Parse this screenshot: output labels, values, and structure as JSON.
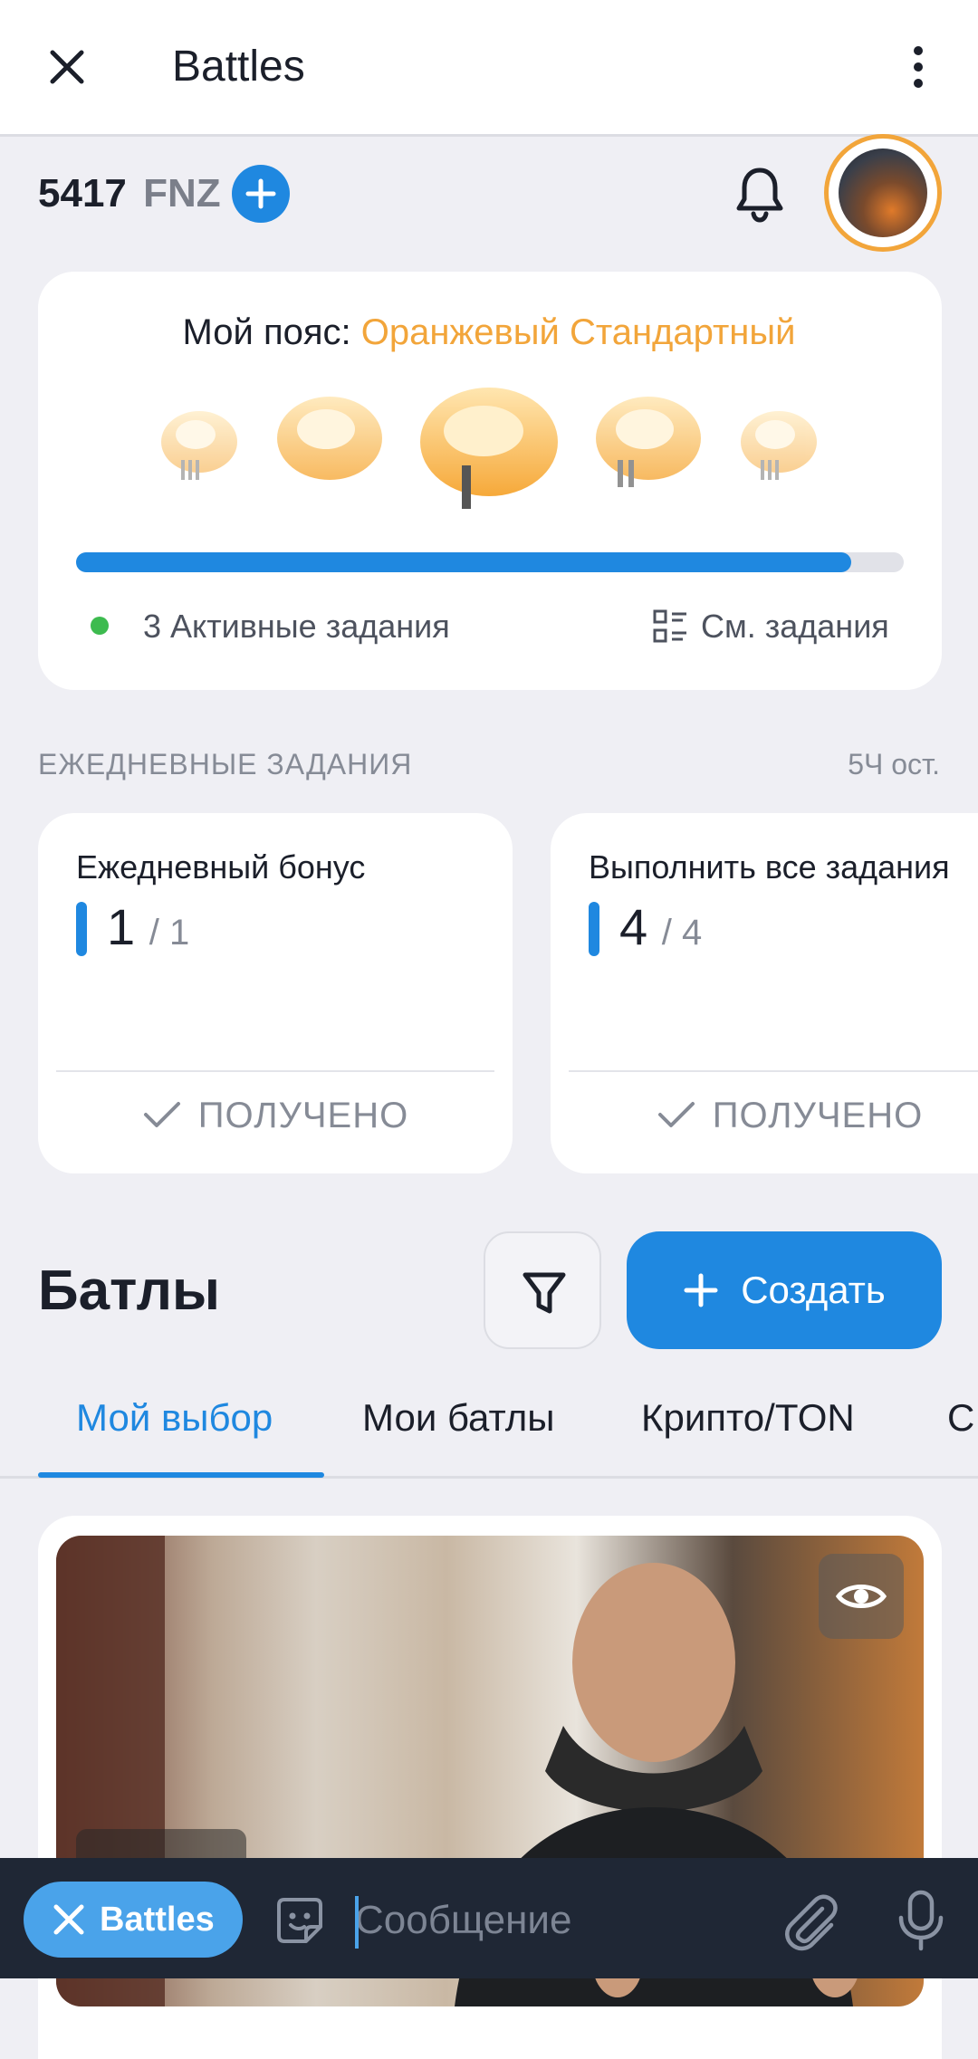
{
  "app_bar": {
    "title": "Battles"
  },
  "balance": {
    "amount": "5417",
    "currency": "FNZ"
  },
  "belt": {
    "label": "Мой пояс:",
    "name": "Оранжевый Стандартный",
    "progress": 0.936,
    "active_tasks": "3 Активные задания",
    "see_tasks": "См. задания"
  },
  "daily": {
    "section_title": "ЕЖЕДНЕВНЫЕ ЗАДАНИЯ",
    "time_left": "5Ч ост.",
    "cards": [
      {
        "name": "Ежедневный бонус",
        "value": "1",
        "total": "/ 1",
        "status": "ПОЛУЧЕНО"
      },
      {
        "name": "Выполнить все задания",
        "value": "4",
        "total": "/ 4",
        "status": "ПОЛУЧЕНО"
      }
    ]
  },
  "battles": {
    "title": "Батлы",
    "create_label": "Создать",
    "tabs": [
      "Мой выбор",
      "Мои батлы",
      "Крипто/TON",
      "С"
    ]
  },
  "composer": {
    "chip_label": "Battles",
    "placeholder": "Сообщение"
  },
  "colors": {
    "accent": "#1f88e0",
    "belt_orange": "#f2a53a",
    "success": "#3dbb4f"
  },
  "icons": [
    "close-icon",
    "more-vert-icon",
    "plus-icon",
    "bell-icon",
    "tasks-list-icon",
    "check-icon",
    "filter-icon",
    "eye-icon",
    "sticker-icon",
    "paperclip-icon",
    "mic-icon"
  ]
}
